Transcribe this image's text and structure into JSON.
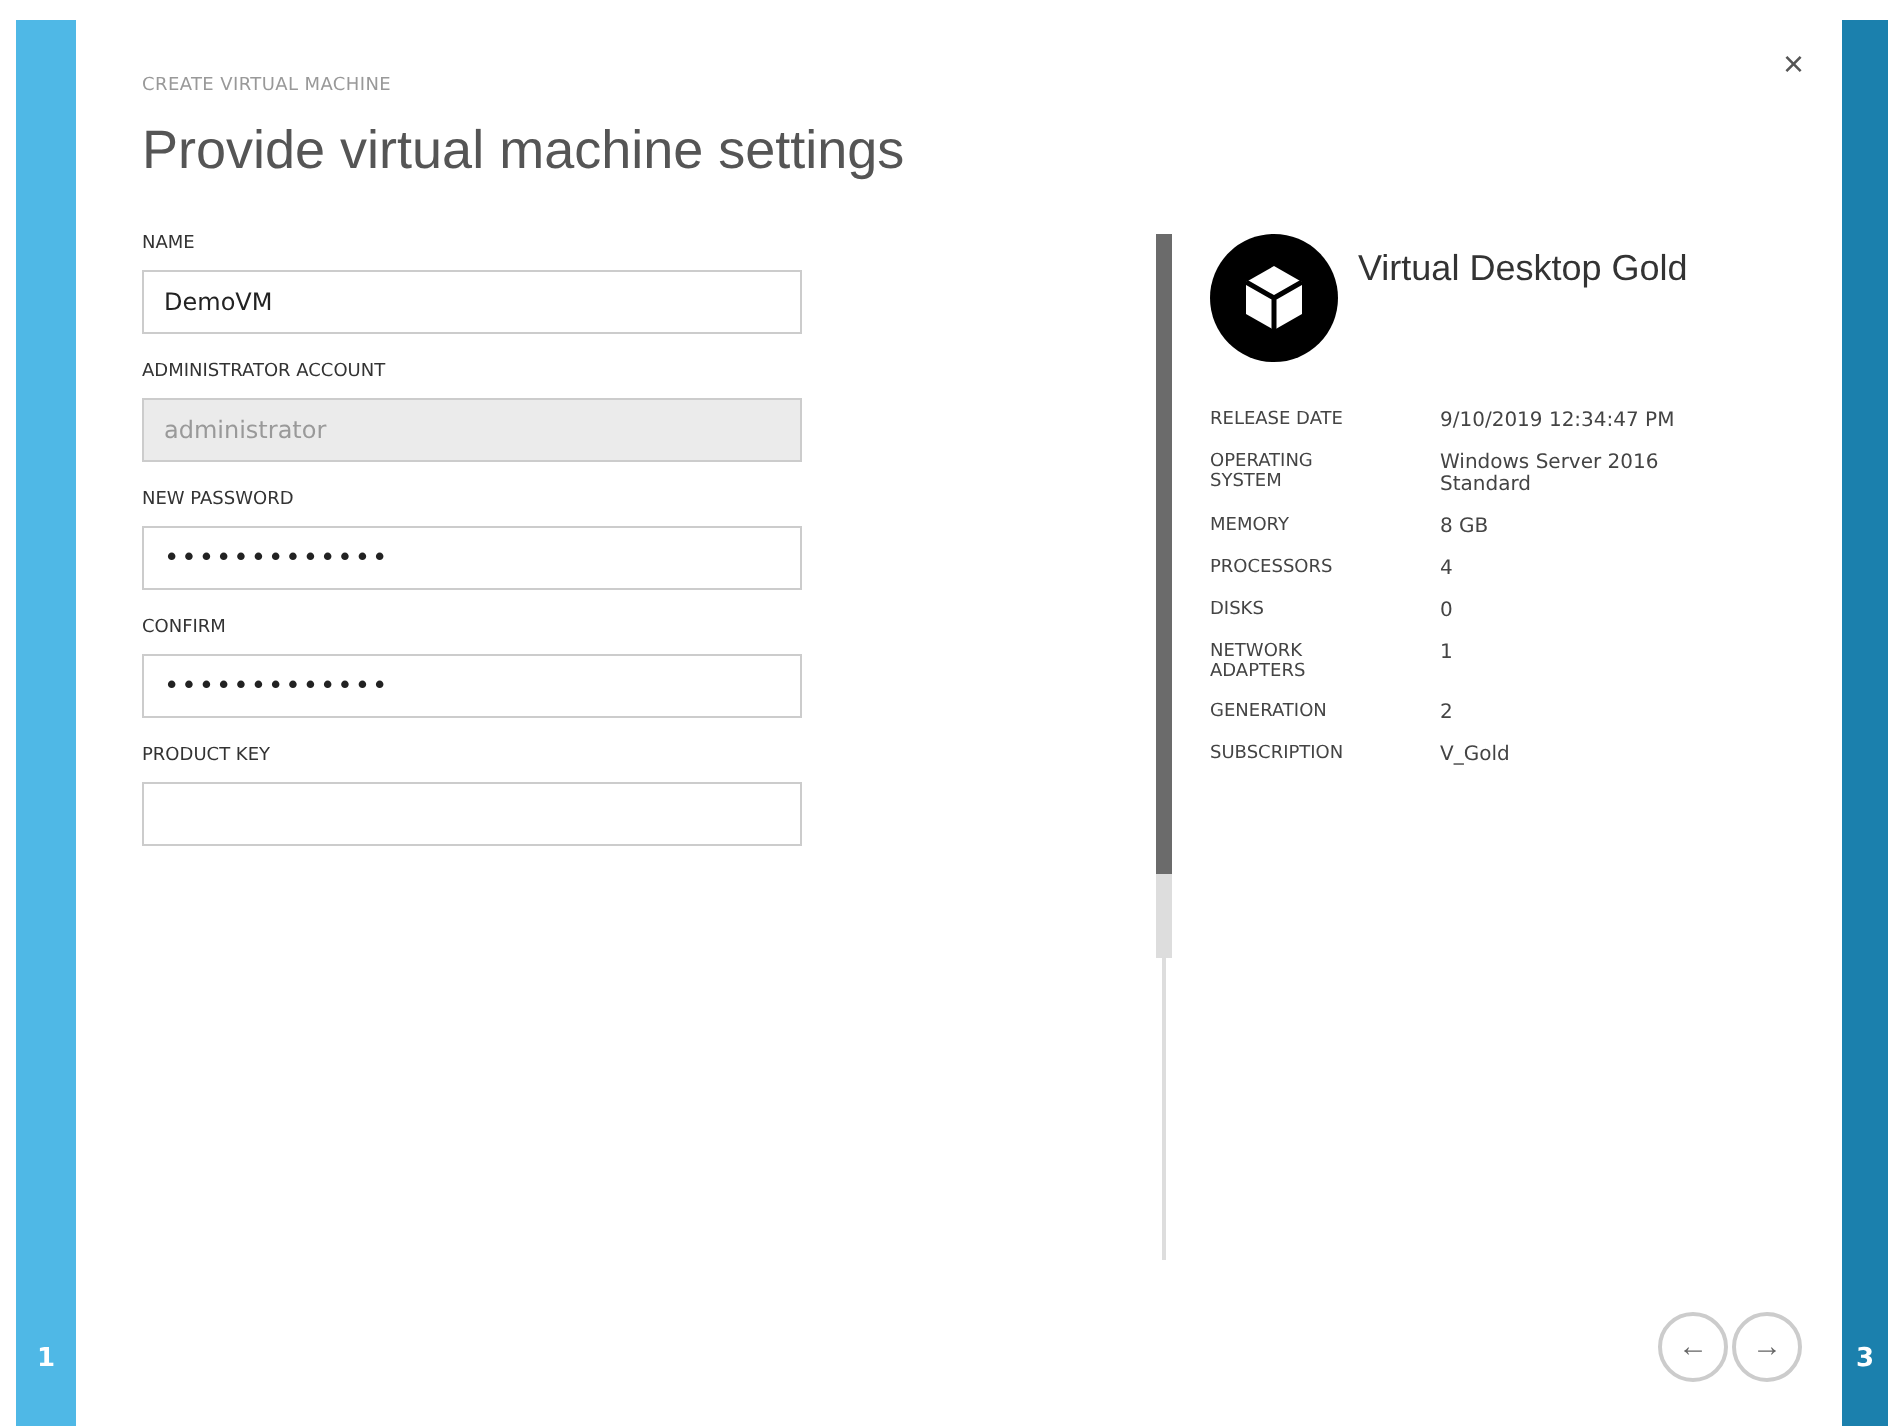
{
  "wizard": {
    "steps": [
      {
        "number": "1",
        "selected": false
      },
      {
        "number": "3",
        "selected": true
      }
    ],
    "close": "×",
    "subtitle": "CREATE VIRTUAL MACHINE",
    "title": "Provide virtual machine settings"
  },
  "form": {
    "fields": [
      {
        "label": "NAME",
        "value": "DemoVM",
        "disabled": false,
        "kind": "text"
      },
      {
        "label": "ADMINISTRATOR ACCOUNT",
        "value": "administrator",
        "disabled": true,
        "kind": "text"
      },
      {
        "label": "NEW PASSWORD",
        "value": "•••••••••••••",
        "disabled": false,
        "kind": "password"
      },
      {
        "label": "CONFIRM",
        "value": "•••••••••••••",
        "disabled": false,
        "kind": "password"
      },
      {
        "label": "PRODUCT KEY",
        "disabled": false,
        "kind": "text"
      }
    ]
  },
  "details": {
    "title": "Virtual Desktop Gold",
    "rows": [
      {
        "label": "RELEASE DATE",
        "value": "9/10/2019 12:34:47 PM"
      },
      {
        "label": "OPERATING SYSTEM",
        "value": "Windows Server 2016 Standard"
      },
      {
        "label": "MEMORY",
        "value": "8 GB"
      },
      {
        "label": "PROCESSORS",
        "value": "4"
      },
      {
        "label": "DISKS",
        "value": "0"
      },
      {
        "label": "NETWORK ADAPTERS",
        "value": "1"
      },
      {
        "label": "GENERATION",
        "value": "2"
      },
      {
        "label": "SUBSCRIPTION",
        "value": "V_Gold"
      }
    ]
  },
  "nav": {
    "back": "←",
    "next": "→"
  }
}
